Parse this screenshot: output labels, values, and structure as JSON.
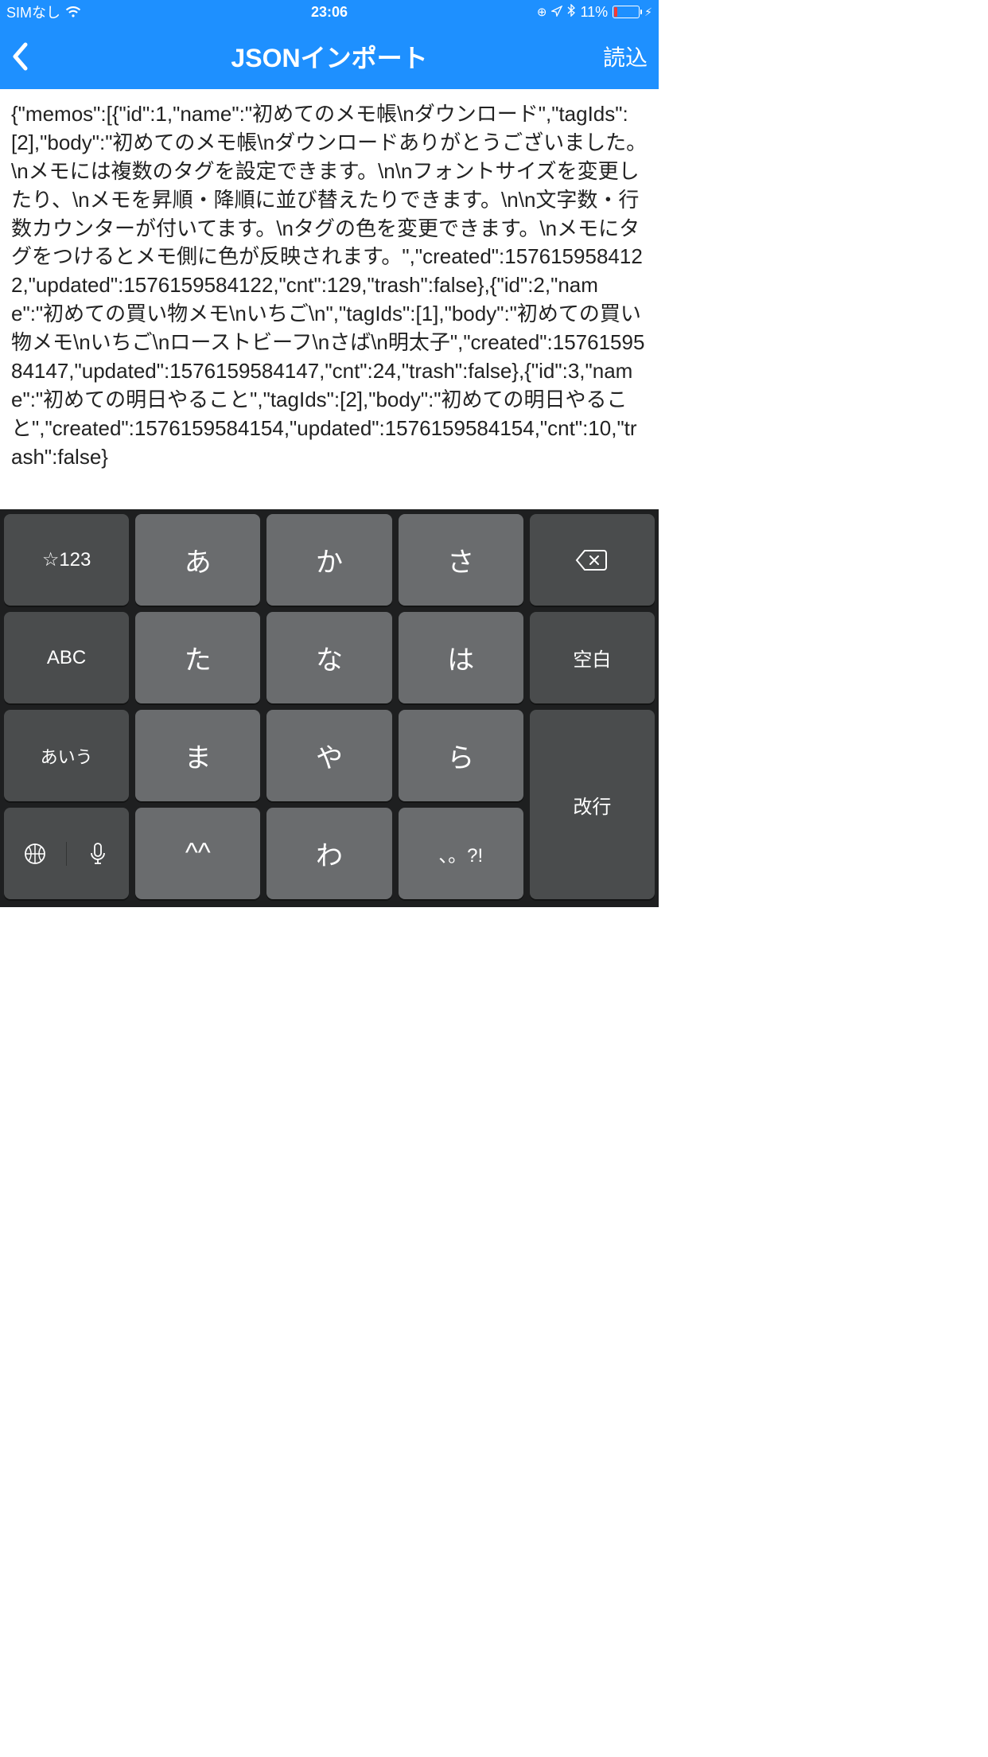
{
  "status": {
    "sim": "SIMなし",
    "time": "23:06",
    "battery_pct": "11%"
  },
  "nav": {
    "title": "JSONインポート",
    "action": "読込"
  },
  "content": {
    "json_text": "{\"memos\":[{\"id\":1,\"name\":\"初めてのメモ帳\\nダウンロード\",\"tagIds\":[2],\"body\":\"初めてのメモ帳\\nダウンロードありがとうございました。\\nメモには複数のタグを設定できます。\\n\\nフォントサイズを変更したり、\\nメモを昇順・降順に並び替えたりできます。\\n\\n文字数・行数カウンターが付いてます。\\nタグの色を変更できます。\\nメモにタグをつけるとメモ側に色が反映されます。\",\"created\":1576159584122,\"updated\":1576159584122,\"cnt\":129,\"trash\":false},{\"id\":2,\"name\":\"初めての買い物メモ\\nいちご\\n\",\"tagIds\":[1],\"body\":\"初めての買い物メモ\\nいちご\\nローストビーフ\\nさば\\n明太子\",\"created\":1576159584147,\"updated\":1576159584147,\"cnt\":24,\"trash\":false},{\"id\":3,\"name\":\"初めての明日やること\",\"tagIds\":[2],\"body\":\"初めての明日やること\",\"created\":1576159584154,\"updated\":1576159584154,\"cnt\":10,\"trash\":false}"
  },
  "keyboard": {
    "r1": {
      "c1": "☆123",
      "c2": "あ",
      "c3": "か",
      "c4": "さ"
    },
    "r2": {
      "c1": "ABC",
      "c2": "た",
      "c3": "な",
      "c4": "は",
      "c5": "空白"
    },
    "r3": {
      "c1": "あいう",
      "c2": "ま",
      "c3": "や",
      "c4": "ら",
      "c5": "改行"
    },
    "r4": {
      "c2": "^^",
      "c3": "わ",
      "c4": "、。?!"
    }
  }
}
